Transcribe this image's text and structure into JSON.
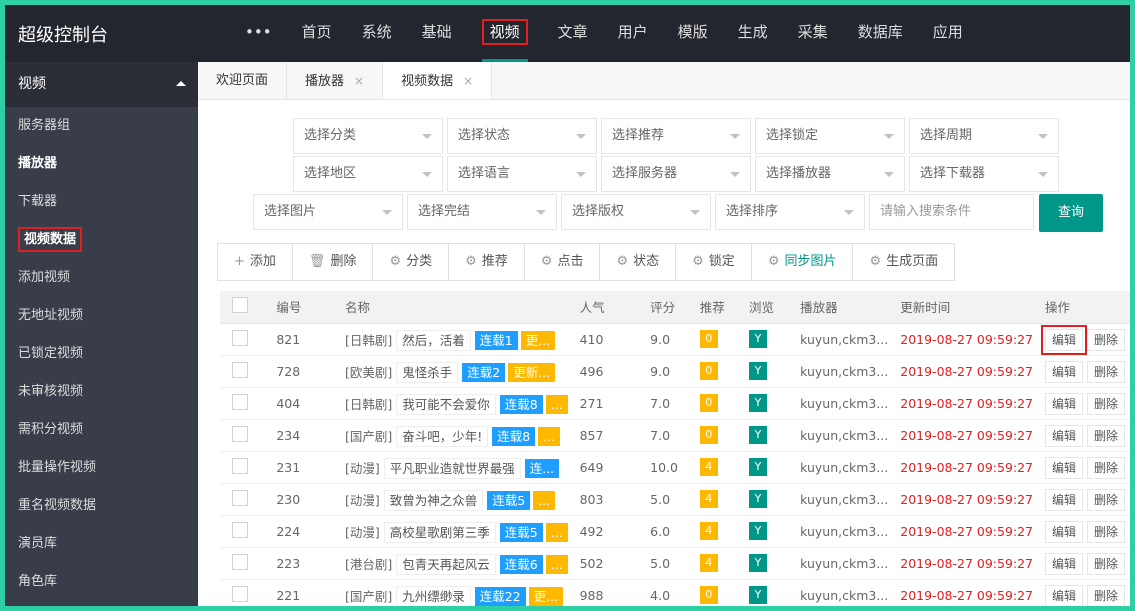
{
  "app_title": "超级控制台",
  "nav": {
    "more": "•••",
    "items": [
      "首页",
      "系统",
      "基础",
      "视频",
      "文章",
      "用户",
      "模版",
      "生成",
      "采集",
      "数据库",
      "应用"
    ],
    "active": "视频"
  },
  "sidebar": {
    "header": "视频",
    "items": [
      "服务器组",
      "播放器",
      "下载器",
      "视频数据",
      "添加视频",
      "无地址视频",
      "已锁定视频",
      "未审核视频",
      "需积分视频",
      "批量操作视频",
      "重名视频数据",
      "演员库",
      "角色库"
    ],
    "selected": "视频数据"
  },
  "tabs": [
    {
      "label": "欢迎页面"
    },
    {
      "label": "播放器",
      "close": "×"
    },
    {
      "label": "视频数据",
      "close": "×"
    }
  ],
  "filters": {
    "row1": [
      "选择分类",
      "选择状态",
      "选择推荐",
      "选择锁定",
      "选择周期"
    ],
    "row2": [
      "选择地区",
      "选择语言",
      "选择服务器",
      "选择播放器",
      "选择下载器"
    ],
    "row3": [
      "选择图片",
      "选择完结",
      "选择版权",
      "选择排序"
    ],
    "search_placeholder": "请输入搜索条件",
    "query": "查询"
  },
  "toolbar": [
    {
      "icon": "plus-icon",
      "glyph": "+",
      "label": "添加"
    },
    {
      "icon": "trash-icon",
      "glyph": "🗑",
      "label": "删除"
    },
    {
      "icon": "gear-icon",
      "glyph": "⚙",
      "label": "分类"
    },
    {
      "icon": "gear-icon",
      "glyph": "⚙",
      "label": "推荐"
    },
    {
      "icon": "gear-icon",
      "glyph": "⚙",
      "label": "点击"
    },
    {
      "icon": "gear-icon",
      "glyph": "⚙",
      "label": "状态"
    },
    {
      "icon": "gear-icon",
      "glyph": "⚙",
      "label": "锁定"
    },
    {
      "icon": "gear-icon",
      "glyph": "⚙",
      "label": "同步图片"
    },
    {
      "icon": "gear-icon",
      "glyph": "⚙",
      "label": "生成页面"
    }
  ],
  "table": {
    "headers": [
      "编号",
      "名称",
      "人气",
      "评分",
      "推荐",
      "浏览",
      "播放器",
      "更新时间",
      "操作"
    ],
    "edit": "编辑",
    "delete": "删除",
    "rows": [
      {
        "id": "821",
        "type": "[日韩剧]",
        "name": "然后，活着",
        "serial": "连载1",
        "extra": "更...",
        "hits": "410",
        "score": "9.0",
        "rec": "0",
        "view": "Y",
        "player": "kuyun,ckm3...",
        "time": "2019-08-27 09:59:27"
      },
      {
        "id": "728",
        "type": "[欧美剧]",
        "name": "鬼怪杀手",
        "serial": "连载2",
        "extra": "更新...",
        "hits": "496",
        "score": "9.0",
        "rec": "0",
        "view": "Y",
        "player": "kuyun,ckm3...",
        "time": "2019-08-27 09:59:27"
      },
      {
        "id": "404",
        "type": "[日韩剧]",
        "name": "我可能不会爱你",
        "serial": "连载8",
        "extra": "...",
        "hits": "271",
        "score": "7.0",
        "rec": "0",
        "view": "Y",
        "player": "kuyun,ckm3...",
        "time": "2019-08-27 09:59:27"
      },
      {
        "id": "234",
        "type": "[国产剧]",
        "name": "奋斗吧，少年!",
        "serial": "连载8",
        "extra": "...",
        "hits": "857",
        "score": "7.0",
        "rec": "0",
        "view": "Y",
        "player": "kuyun,ckm3...",
        "time": "2019-08-27 09:59:27"
      },
      {
        "id": "231",
        "type": "[动漫]",
        "name": "平凡职业造就世界最强",
        "serial": "连...",
        "extra": "",
        "hits": "649",
        "score": "10.0",
        "rec": "4",
        "view": "Y",
        "player": "kuyun,ckm3...",
        "time": "2019-08-27 09:59:27"
      },
      {
        "id": "230",
        "type": "[动漫]",
        "name": "致曾为神之众兽",
        "serial": "连载5",
        "extra": "...",
        "hits": "803",
        "score": "5.0",
        "rec": "4",
        "view": "Y",
        "player": "kuyun,ckm3...",
        "time": "2019-08-27 09:59:27"
      },
      {
        "id": "224",
        "type": "[动漫]",
        "name": "高校星歌剧第三季",
        "serial": "连载5",
        "extra": "...",
        "hits": "492",
        "score": "6.0",
        "rec": "4",
        "view": "Y",
        "player": "kuyun,ckm3...",
        "time": "2019-08-27 09:59:27"
      },
      {
        "id": "223",
        "type": "[港台剧]",
        "name": "包青天再起风云",
        "serial": "连载6",
        "extra": "...",
        "hits": "502",
        "score": "5.0",
        "rec": "4",
        "view": "Y",
        "player": "kuyun,ckm3...",
        "time": "2019-08-27 09:59:27"
      },
      {
        "id": "221",
        "type": "[国产剧]",
        "name": "九州缥缈录",
        "serial": "连载22",
        "extra": "更...",
        "hits": "988",
        "score": "4.0",
        "rec": "0",
        "view": "Y",
        "player": "kuyun,ckm3...",
        "time": "2019-08-27 09:59:27"
      }
    ]
  },
  "colors": {
    "accent": "#009688",
    "border": "#2fcfa6",
    "highlight": "#e02020",
    "badge_blue": "#1e9fff",
    "badge_orange": "#ffb800"
  }
}
